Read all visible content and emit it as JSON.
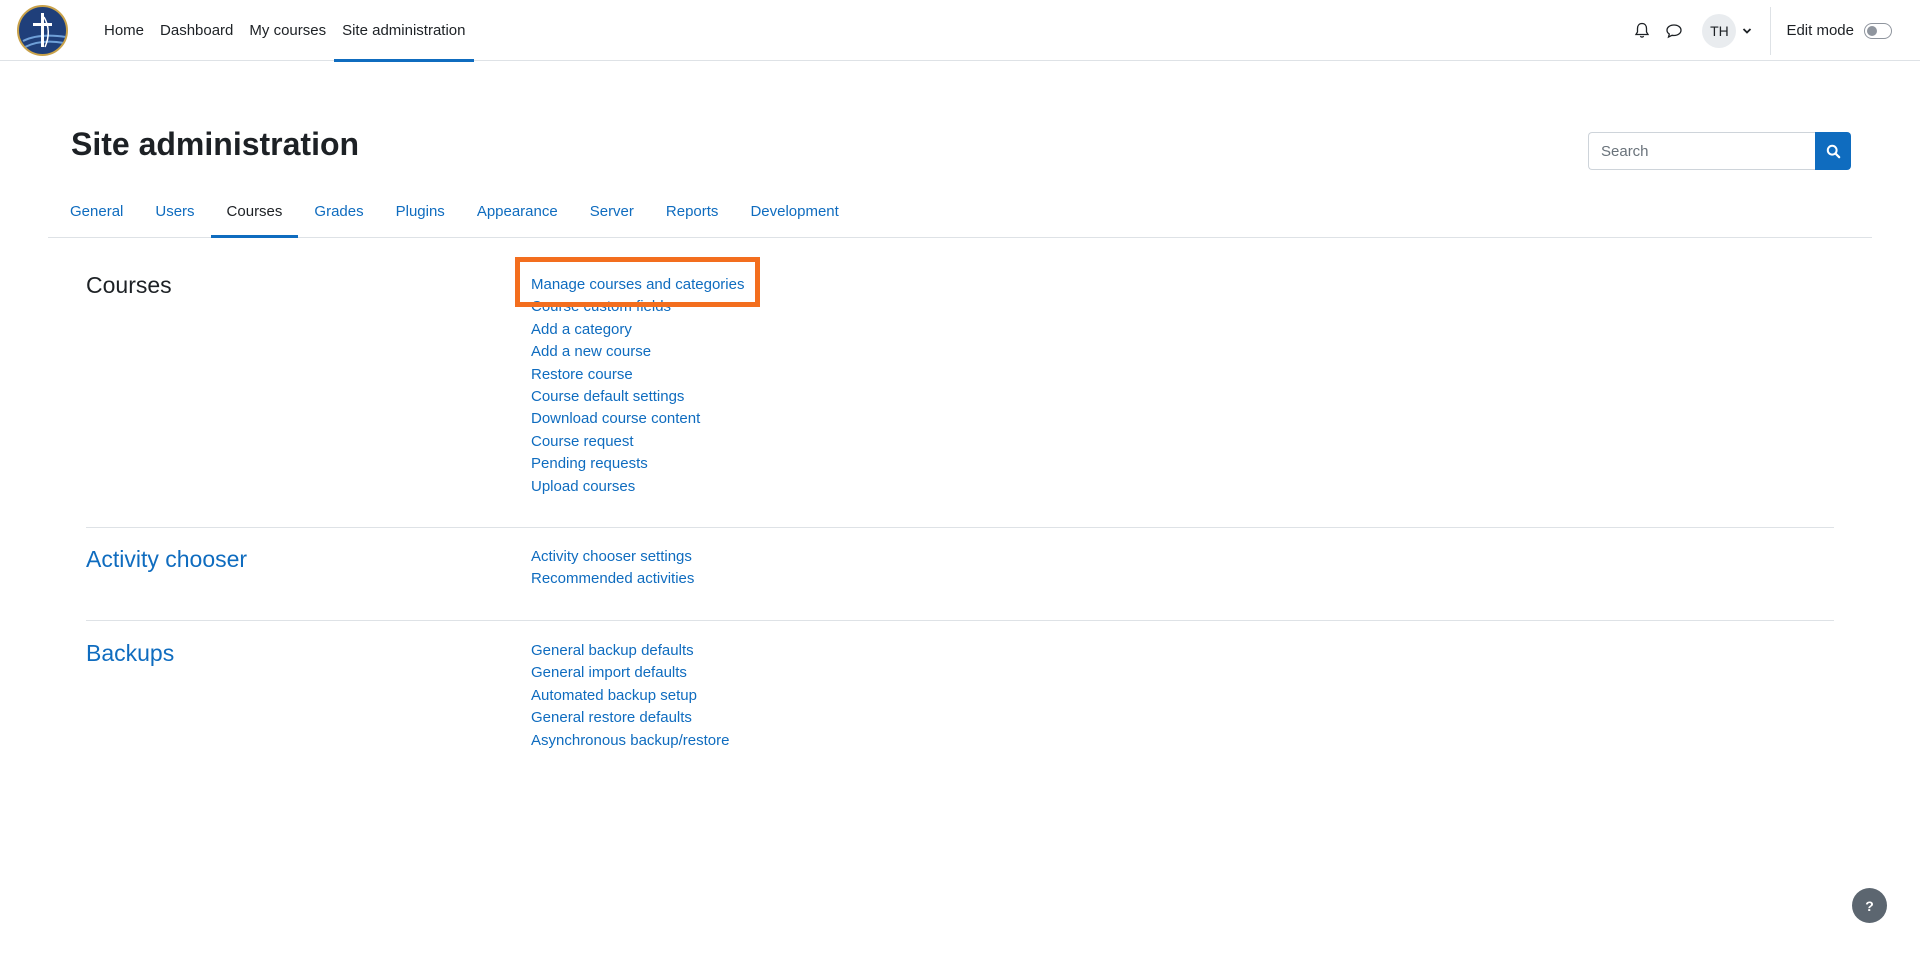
{
  "navbar": {
    "logo": "site-logo",
    "items": [
      {
        "label": "Home",
        "active": false
      },
      {
        "label": "Dashboard",
        "active": false
      },
      {
        "label": "My courses",
        "active": false
      },
      {
        "label": "Site administration",
        "active": true
      }
    ],
    "notifications_icon": "bell-icon",
    "messages_icon": "chat-bubble-icon",
    "user_initials": "TH",
    "edit_mode_label": "Edit mode",
    "edit_mode_on": false
  },
  "page": {
    "title": "Site administration",
    "search_placeholder": "Search"
  },
  "tabs": [
    {
      "label": "General",
      "active": false
    },
    {
      "label": "Users",
      "active": false
    },
    {
      "label": "Courses",
      "active": true
    },
    {
      "label": "Grades",
      "active": false
    },
    {
      "label": "Plugins",
      "active": false
    },
    {
      "label": "Appearance",
      "active": false
    },
    {
      "label": "Server",
      "active": false
    },
    {
      "label": "Reports",
      "active": false
    },
    {
      "label": "Development",
      "active": false
    }
  ],
  "sections": [
    {
      "title": "Courses",
      "links": [
        "Manage courses and categories",
        "Course custom fields",
        "Add a category",
        "Add a new course",
        "Restore course",
        "Course default settings",
        "Download course content",
        "Course request",
        "Pending requests",
        "Upload courses"
      ]
    },
    {
      "title": "Activity chooser",
      "links": [
        "Activity chooser settings",
        "Recommended activities"
      ]
    },
    {
      "title": "Backups",
      "links": [
        "General backup defaults",
        "General import defaults",
        "Automated backup setup",
        "General restore defaults",
        "Asynchronous backup/restore"
      ]
    }
  ],
  "help_button": "?",
  "colors": {
    "link": "#0f6cbf",
    "highlight": "#f36e1e",
    "text": "#1d2125"
  }
}
